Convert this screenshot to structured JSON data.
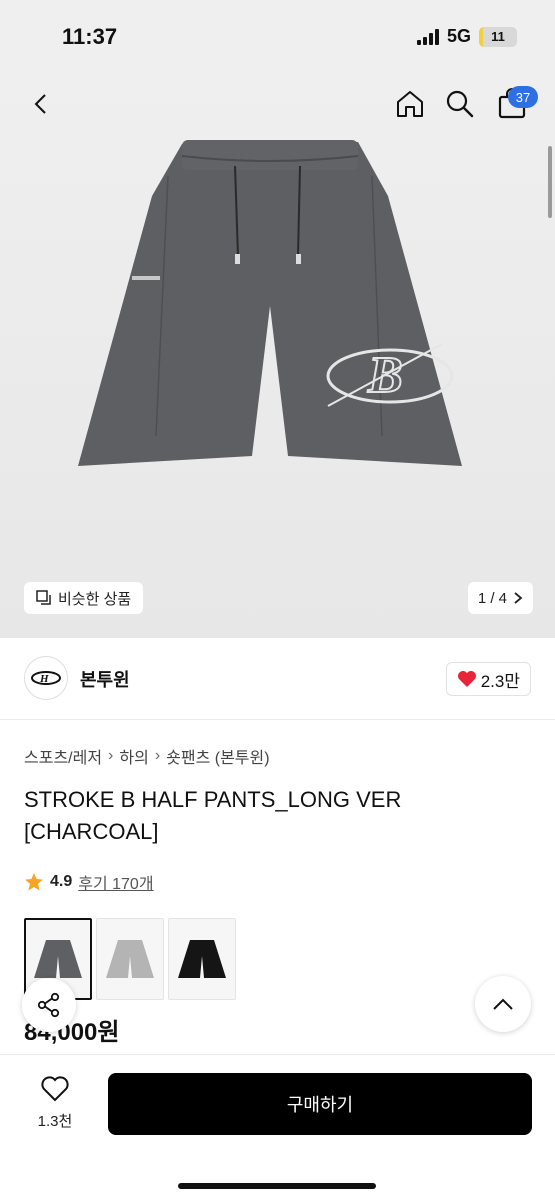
{
  "status": {
    "time": "11:37",
    "network": "5G",
    "battery": "11",
    "battery_level": 0.11
  },
  "nav": {
    "cart_count": "37",
    "icons": [
      "back-icon",
      "home-icon",
      "search-icon",
      "shopping-bag-icon"
    ]
  },
  "gallery": {
    "similar_label": "비슷한 상품",
    "pager": "1 / 4"
  },
  "brand": {
    "name": "본투윈",
    "likes": "2.3만"
  },
  "breadcrumb": [
    "스포츠/레저",
    "하의",
    "숏팬츠 (본투윈)"
  ],
  "product": {
    "title": "STROKE B HALF PANTS_LONG VER [CHARCOAL]",
    "rating": "4.9",
    "reviews": "후기 170개",
    "price": "84,000원",
    "colors": [
      "#5f6063",
      "#b4b4b4",
      "#151515"
    ]
  },
  "footer": {
    "wish_count": "1.3천",
    "buy_label": "구매하기"
  },
  "theme": {
    "accent": "#2f6fe4",
    "heart": "#e8233a",
    "star": "#f6a623"
  }
}
